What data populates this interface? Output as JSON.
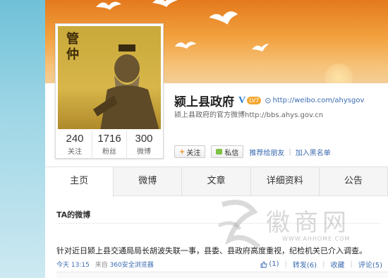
{
  "profile": {
    "name": "颍上县政府",
    "verified_badge": "V",
    "level": "LV7",
    "weibo_url": "http://weibo.com/ahysgov",
    "description": "颍上县政府的官方微博http://bbs.ahys.gov.cn",
    "avatar_seal_text": "管仲",
    "stats": [
      {
        "value": "240",
        "label": "关注"
      },
      {
        "value": "1716",
        "label": "粉丝"
      },
      {
        "value": "300",
        "label": "微博"
      }
    ]
  },
  "actions": {
    "follow": "关注",
    "message": "私信",
    "recommend": "推荐给朋友",
    "blacklist": "加入黑名单"
  },
  "tabs": [
    "主页",
    "微博",
    "文章",
    "详细资料",
    "公告"
  ],
  "feed": {
    "section_title": "TA的微博",
    "post": {
      "text": "针对近日颍上县交通局局长胡波失联一事，县委、县政府高度重视，纪检机关已介入调查。",
      "time": "今天 13:15",
      "source_prefix": "来自",
      "source": "360安全浏览器",
      "likes": "(1)",
      "repost": "转发(6)",
      "favorite": "收藏",
      "comment": "评论(5)"
    }
  },
  "watermark": {
    "text": "徽商网",
    "url": "WWW.AHHOME.COM"
  },
  "colors": {
    "link": "#3a6bb0",
    "accent": "#f08b1a",
    "cover_top": "#e47a1d"
  }
}
